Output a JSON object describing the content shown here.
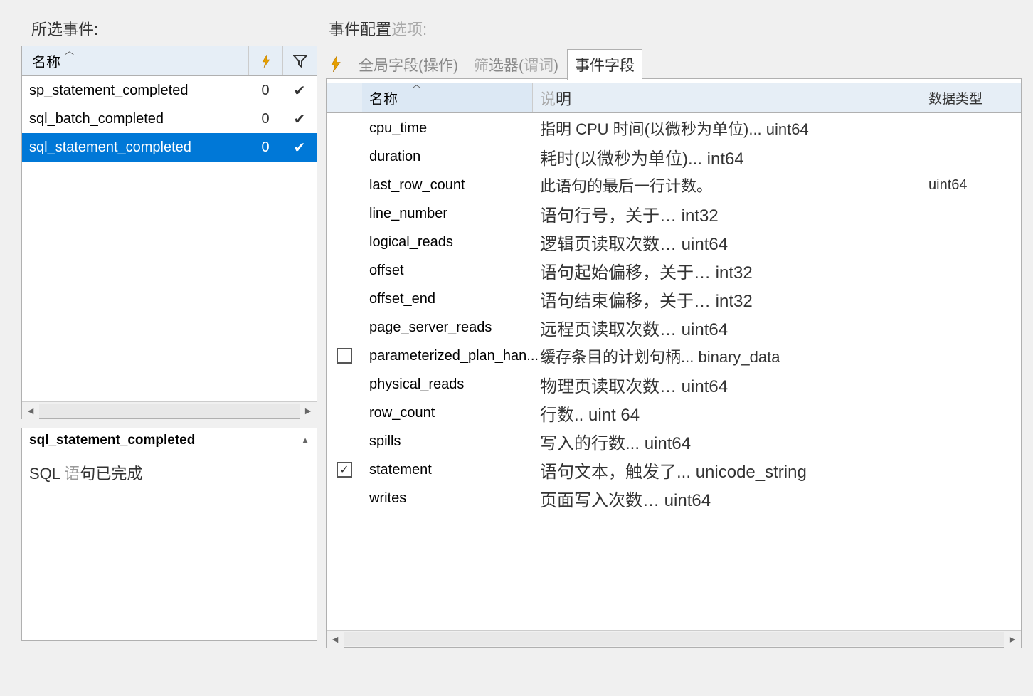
{
  "left": {
    "title": "所选事件:",
    "header": {
      "name": "名称"
    },
    "events": [
      {
        "name": "sp_statement_completed",
        "count": "0",
        "check": "✔"
      },
      {
        "name": "sql_batch_completed",
        "count": "0",
        "check": "✔"
      },
      {
        "name": "sql_statement_completed",
        "count": "0",
        "check": "✔"
      }
    ]
  },
  "desc": {
    "title": "sql_statement_completed",
    "body_prefix": "SQL ",
    "body_gray1": "语",
    "body_mid": "句已完成"
  },
  "right": {
    "title_dark": "事件配置",
    "title_gray": "选项:",
    "tabs": {
      "global": "全局字段(操作)",
      "filter_pre": "筛",
      "filter_mid": "选器(",
      "filter_g2": "谓词",
      "filter_end": ")",
      "event_fields": "事件字段"
    },
    "header": {
      "name": "名称",
      "desc_g": "说",
      "desc_d": "明",
      "type": "数据类型"
    },
    "fields": [
      {
        "name": "cpu_time",
        "desc": "指明 CPU 时间(以微秒为单位)...",
        "type": "uint64",
        "checked": null,
        "inline_type": true,
        "small": true
      },
      {
        "name": "duration",
        "desc": "耗时(以微秒为单位)...",
        "type": "int64",
        "checked": null,
        "inline_type": true
      },
      {
        "name": "last_row_count",
        "desc": "此语句的最后一行计数。",
        "type": "uint64",
        "checked": null,
        "inline_type": false,
        "small": true
      },
      {
        "name": "line_number",
        "desc": "语句行号，关于…",
        "type": "int32",
        "checked": null,
        "inline_type": true
      },
      {
        "name": "logical_reads",
        "desc": "逻辑页读取次数…",
        "type": "uint64",
        "checked": null,
        "inline_type": true
      },
      {
        "name": "offset",
        "desc": "语句起始偏移，关于…",
        "type": "int32",
        "checked": null,
        "inline_type": true
      },
      {
        "name": "offset_end",
        "desc": "语句结束偏移，关于…",
        "type": "int32",
        "checked": null,
        "inline_type": true
      },
      {
        "name": "page_server_reads",
        "desc": "远程页读取次数…",
        "type": "uint64",
        "checked": null,
        "inline_type": true
      },
      {
        "name": "parameterized_plan_han...",
        "desc": "缓存条目的计划句柄...",
        "type": "binary_data",
        "checked": false,
        "inline_type": true,
        "small": true
      },
      {
        "name": "physical_reads",
        "desc": "物理页读取次数…",
        "type": "uint64",
        "checked": null,
        "inline_type": true
      },
      {
        "name": "row_count",
        "desc": "行数..",
        "type": "uint 64",
        "checked": null,
        "inline_type": true
      },
      {
        "name": "spills",
        "desc": "写入的行数...",
        "type": "uint64",
        "checked": null,
        "inline_type": true
      },
      {
        "name": "statement",
        "desc": "语句文本，触发了...",
        "type": "unicode_string",
        "checked": true,
        "inline_type": true
      },
      {
        "name": "writes",
        "desc": "页面写入次数…",
        "type": "uint64",
        "checked": null,
        "inline_type": true
      }
    ]
  }
}
